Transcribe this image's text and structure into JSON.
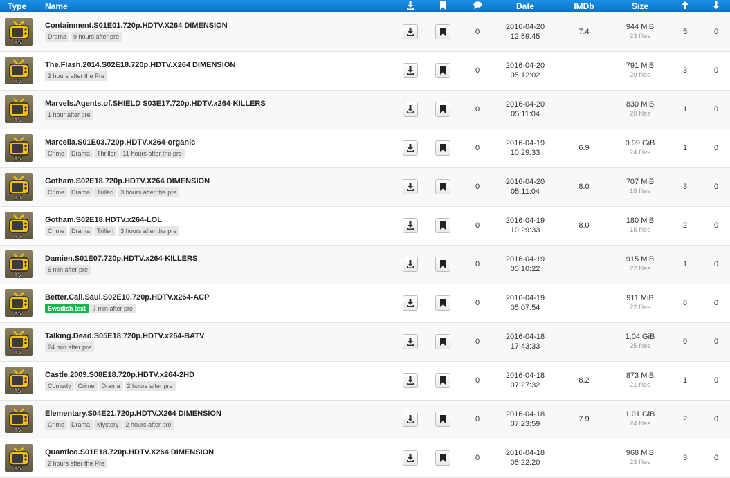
{
  "header": {
    "type": "Type",
    "name": "Name",
    "date": "Date",
    "imdb": "IMDb",
    "size": "Size"
  },
  "colors": {
    "header_bg": "#0a72c8",
    "swedish_tag": "#16b44a"
  },
  "rows": [
    {
      "name": "Containment.S01E01.720p.HDTV.X264 DIMENSION",
      "tags": [
        "Drama",
        "9 hours after pre"
      ],
      "comments": "0",
      "date": "2016-04-20",
      "time": "12:59:45",
      "imdb": "7.4",
      "size": "944 MiB",
      "files": "23 files",
      "seeders": "5",
      "leechers": "0"
    },
    {
      "name": "The.Flash.2014.S02E18.720p.HDTV.X264 DIMENSION",
      "tags": [
        "2 hours after the Pre"
      ],
      "comments": "0",
      "date": "2016-04-20",
      "time": "05:12:02",
      "imdb": "",
      "size": "791 MiB",
      "files": "20 files",
      "seeders": "3",
      "leechers": "0"
    },
    {
      "name": "Marvels.Agents.of.SHIELD S03E17.720p.HDTV.x264-KILLERS",
      "tags": [
        "1 hour after pre"
      ],
      "comments": "0",
      "date": "2016-04-20",
      "time": "05:11:04",
      "imdb": "",
      "size": "830 MiB",
      "files": "20 files",
      "seeders": "1",
      "leechers": "0"
    },
    {
      "name": "Marcella.S01E03.720p.HDTV.x264-organic",
      "tags": [
        "Crime",
        "Drama",
        "Thriller",
        "11 hours after the pre"
      ],
      "comments": "0",
      "date": "2016-04-19",
      "time": "10:29:33",
      "imdb": "6.9",
      "size": "0.99 GiB",
      "files": "24 files",
      "seeders": "1",
      "leechers": "0"
    },
    {
      "name": "Gotham.S02E18.720p.HDTV.X264 DIMENSION",
      "tags": [
        "Crime",
        "Drama",
        "Trilleri",
        "3 hours after the pre"
      ],
      "comments": "0",
      "date": "2016-04-20",
      "time": "05:11:04",
      "imdb": "8.0",
      "size": "707 MiB",
      "files": "18 files",
      "seeders": "3",
      "leechers": "0"
    },
    {
      "name": "Gotham.S02E18.HDTV.x264-LOL",
      "tags": [
        "Crime",
        "Drama",
        "Trilleri",
        "3 hours after the pre"
      ],
      "comments": "0",
      "date": "2016-04-19",
      "time": "10:29:33",
      "imdb": "8.0",
      "size": "180 MiB",
      "files": "15 files",
      "seeders": "2",
      "leechers": "0"
    },
    {
      "name": "Damien.S01E07.720p.HDTV.x264-KILLERS",
      "tags": [
        "6 min after pre"
      ],
      "comments": "0",
      "date": "2016-04-19",
      "time": "05:10:22",
      "imdb": "",
      "size": "915 MiB",
      "files": "22 files",
      "seeders": "1",
      "leechers": "0"
    },
    {
      "name": "Better.Call.Saul.S02E10.720p.HDTV.x264-ACP",
      "green": "Swedish text",
      "tags": [
        "7 min after pre"
      ],
      "comments": "0",
      "date": "2016-04-19",
      "time": "05:07:54",
      "imdb": "",
      "size": "911 MiB",
      "files": "22 files",
      "seeders": "8",
      "leechers": "0"
    },
    {
      "name": "Talking.Dead.S05E18.720p.HDTV.x264-BATV",
      "tags": [
        "24 min after pre"
      ],
      "comments": "0",
      "date": "2016-04-18",
      "time": "17:43:33",
      "imdb": "",
      "size": "1.04 GiB",
      "files": "25 files",
      "seeders": "0",
      "leechers": "0"
    },
    {
      "name": "Castle.2009.S08E18.720p.HDTV.x264-2HD",
      "tags": [
        "Comedy",
        "Crime",
        "Drama",
        "2 hours after pre"
      ],
      "comments": "0",
      "date": "2016-04-18",
      "time": "07:27:32",
      "imdb": "8.2",
      "size": "873 MiB",
      "files": "21 files",
      "seeders": "1",
      "leechers": "0"
    },
    {
      "name": "Elementary.S04E21.720p.HDTV.X264 DIMENSION",
      "tags": [
        "Crime",
        "Drama",
        "Mystery",
        "2 hours after pre"
      ],
      "comments": "0",
      "date": "2016-04-18",
      "time": "07:23:59",
      "imdb": "7.9",
      "size": "1.01 GiB",
      "files": "24 files",
      "seeders": "2",
      "leechers": "0"
    },
    {
      "name": "Quantico.S01E18.720p.HDTV.X264 DIMENSION",
      "tags": [
        "2 hours after the Pre"
      ],
      "comments": "0",
      "date": "2016-04-18",
      "time": "05:22:20",
      "imdb": "",
      "size": "968 MiB",
      "files": "23 files",
      "seeders": "3",
      "leechers": "0"
    }
  ]
}
